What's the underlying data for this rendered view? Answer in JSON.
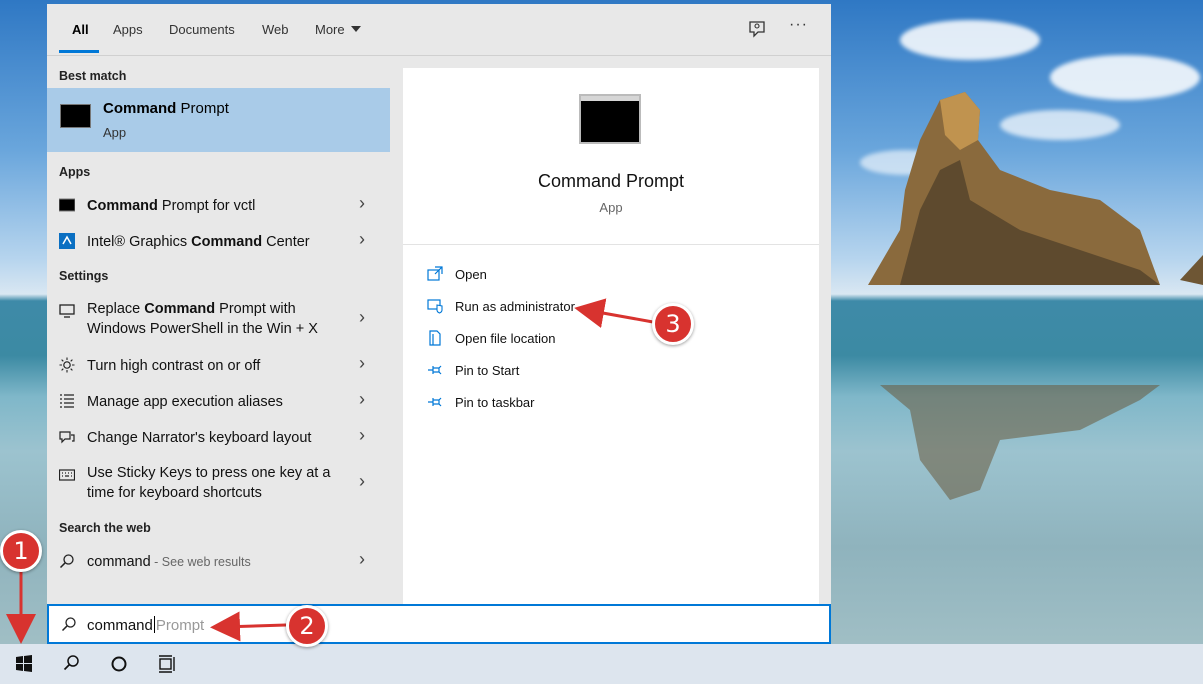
{
  "tabs": {
    "all": "All",
    "apps": "Apps",
    "documents": "Documents",
    "web": "Web",
    "more": "More",
    "more_icon": "chevron-down-icon",
    "ellipsis": "···"
  },
  "best_match": {
    "heading": "Best match",
    "title_bold": "Command",
    "title_rest": " Prompt",
    "subtitle": "App"
  },
  "apps_section": {
    "heading": "Apps",
    "items": [
      {
        "bold": "Command",
        "rest": " Prompt for vctl"
      },
      {
        "pre": "Intel® Graphics ",
        "bold": "Command",
        "rest": " Center"
      }
    ]
  },
  "settings_section": {
    "heading": "Settings",
    "items": [
      {
        "pre": "Replace ",
        "bold": "Command",
        "rest": " Prompt with Windows PowerShell in the Win + X"
      },
      {
        "label": "Turn high contrast on or off"
      },
      {
        "label": "Manage app execution aliases"
      },
      {
        "label": "Change Narrator's keyboard layout"
      },
      {
        "label": "Use Sticky Keys to press one key at a time for keyboard shortcuts"
      }
    ]
  },
  "web_section": {
    "heading": "Search the web",
    "query": "command",
    "hint": " - See web results"
  },
  "preview": {
    "title": "Command Prompt",
    "subtitle": "App",
    "actions": [
      {
        "label": "Open",
        "icon": "open-icon"
      },
      {
        "label": "Run as administrator",
        "icon": "shield-icon"
      },
      {
        "label": "Open file location",
        "icon": "file-location-icon"
      },
      {
        "label": "Pin to Start",
        "icon": "pin-icon"
      },
      {
        "label": "Pin to taskbar",
        "icon": "pin-icon"
      }
    ]
  },
  "search": {
    "typed": "command",
    "suggestion": "Prompt"
  },
  "taskbar": {
    "items": [
      "windows-start-icon",
      "search-icon",
      "cortana-icon",
      "task-view-icon"
    ]
  },
  "annotations": {
    "badge1": "1",
    "badge2": "2",
    "badge3": "3",
    "color": "#d8332f"
  },
  "colors": {
    "accent": "#0078d7",
    "best_match_bg": "#a9cbe8",
    "panel_bg": "#e8e8e8"
  }
}
